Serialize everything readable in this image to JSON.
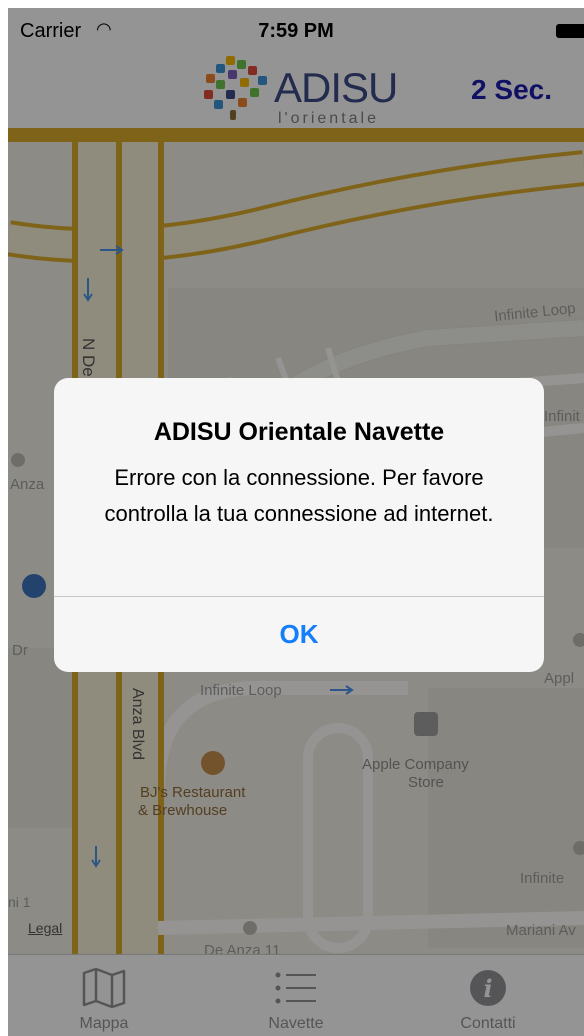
{
  "status_bar": {
    "carrier": "Carrier",
    "time": "7:59 PM"
  },
  "nav": {
    "logo_text": "ADISU",
    "logo_sub": "l'orientale",
    "timer": "2 Sec."
  },
  "map": {
    "labels": {
      "infinite_loop_top": "Infinite Loop",
      "infinite_right": "Infinit",
      "n_de_anza": "N De A",
      "anza_left": "Anza",
      "dr": "Dr",
      "appl": "Appl",
      "infinite_loop_mid": "Infinite Loop",
      "anza_blvd": "Anza Blvd",
      "apple_store_1": "Apple Company",
      "apple_store_2": "Store",
      "bjs_1": "BJ's Restaurant",
      "bjs_2": "& Brewhouse",
      "infinite_bottom": "Infinite",
      "ni_1": "ni 1",
      "legal": "Legal",
      "mariani": "Mariani Av",
      "de_anza_11": "De Anza 11"
    }
  },
  "alert": {
    "title": "ADISU Orientale Navette",
    "message": "Errore con la connessione. Per favore controlla la tua connessione ad internet.",
    "ok_label": "OK"
  },
  "tabs": [
    {
      "label": "Mappa",
      "icon": "map-icon"
    },
    {
      "label": "Navette",
      "icon": "list-icon"
    },
    {
      "label": "Contatti",
      "icon": "info-icon"
    }
  ],
  "colors": {
    "road_yellow": "#d3a52a",
    "alert_button": "#147efb",
    "timer": "#1c1ca8",
    "brand": "#3b4a84"
  }
}
